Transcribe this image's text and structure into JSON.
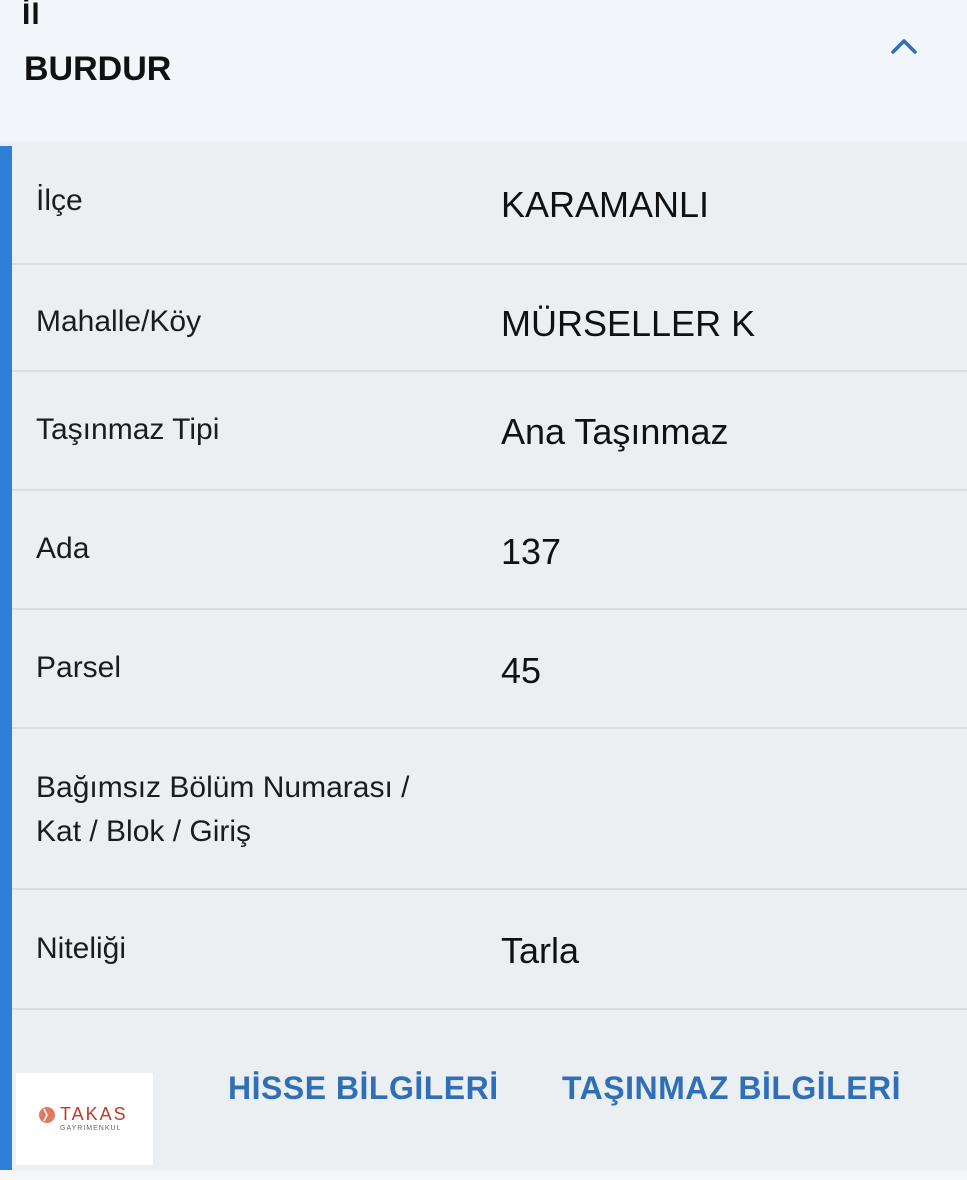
{
  "header": {
    "field_label": "İl",
    "field_value": "BURDUR",
    "toggle_icon": "chevron-up-icon"
  },
  "rows": [
    {
      "label": "İlçe",
      "value": "KARAMANLI"
    },
    {
      "label": "Mahalle/Köy",
      "value": "MÜRSELLER K"
    },
    {
      "label": "Taşınmaz Tipi",
      "value": "Ana Taşınmaz"
    },
    {
      "label": "Ada",
      "value": "137"
    },
    {
      "label": "Parsel",
      "value": "45"
    },
    {
      "label_line1": "Bağımsız Bölüm Numarası /",
      "label_line2": "Kat / Blok / Giriş",
      "value": ""
    },
    {
      "label": "Niteliği",
      "value": "Tarla"
    }
  ],
  "footer": {
    "share_button": "HİSSE BİLGİLERİ",
    "property_button": "TAŞINMAZ BİLGİLERİ"
  },
  "logo": {
    "name": "TAKAS",
    "subtitle": "GAYRIMENKUL"
  },
  "colors": {
    "accent": "#2f7fd8",
    "link": "#2e6fb8",
    "background": "#e9eef2"
  }
}
